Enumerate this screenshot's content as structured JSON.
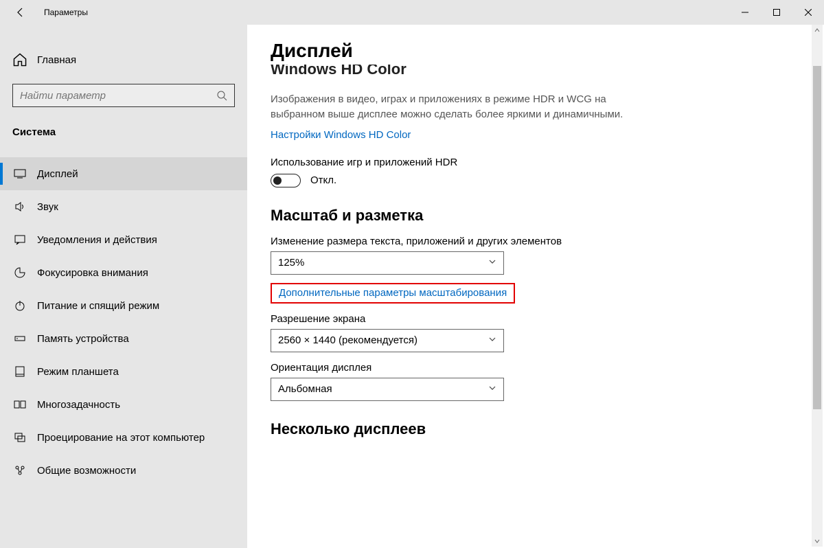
{
  "window": {
    "title": "Параметры"
  },
  "sidebar": {
    "home": "Главная",
    "search_placeholder": "Найти параметр",
    "section": "Система",
    "items": [
      {
        "label": "Дисплей"
      },
      {
        "label": "Звук"
      },
      {
        "label": "Уведомления и действия"
      },
      {
        "label": "Фокусировка внимания"
      },
      {
        "label": "Питание и спящий режим"
      },
      {
        "label": "Память устройства"
      },
      {
        "label": "Режим планшета"
      },
      {
        "label": "Многозадачность"
      },
      {
        "label": "Проецирование на этот компьютер"
      },
      {
        "label": "Общие возможности"
      }
    ]
  },
  "main": {
    "page_title": "Дисплей",
    "hd_heading": "Windows HD Color",
    "hd_desc": "Изображения в видео, играх и приложениях в режиме HDR и WCG на выбранном выше дисплее можно сделать более яркими и динамичными.",
    "hd_link": "Настройки Windows HD Color",
    "hdr_apps_label": "Использование игр и приложений HDR",
    "toggle_state": "Откл.",
    "scale_heading": "Масштаб и разметка",
    "scale_label": "Изменение размера текста, приложений и других элементов",
    "scale_value": "125%",
    "advanced_scaling": "Дополнительные параметры масштабирования",
    "resolution_label": "Разрешение экрана",
    "resolution_value": "2560 × 1440 (рекомендуется)",
    "orientation_label": "Ориентация дисплея",
    "orientation_value": "Альбомная",
    "multi_heading": "Несколько дисплеев"
  }
}
